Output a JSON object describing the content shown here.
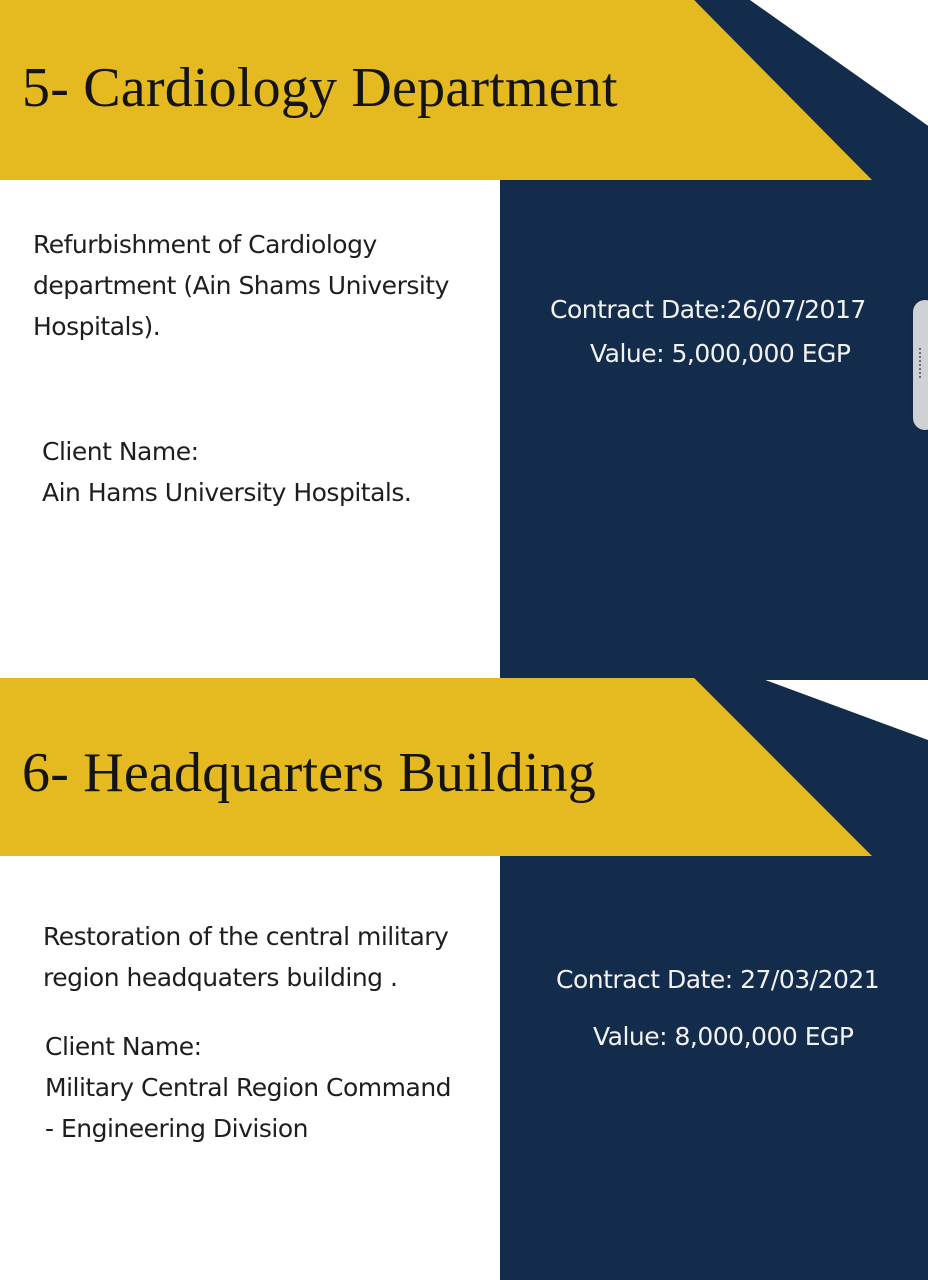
{
  "sections": [
    {
      "title": "5- Cardiology Department",
      "description_lines": [
        "Refurbishment of Cardiology",
        "department (Ain Shams University",
        "Hospitals)."
      ],
      "client_label": "Client Name:",
      "client_lines": [
        "Ain Hams University Hospitals."
      ],
      "contract_date": "Contract Date:26/07/2017",
      "value": "Value: 5,000,000 EGP"
    },
    {
      "title": "6- Headquarters Building",
      "description_lines": [
        "Restoration of the central military",
        "region headquaters building ."
      ],
      "client_label": "Client Name:",
      "client_lines": [
        "Military Central Region Command",
        "- Engineering Division"
      ],
      "contract_date": "Contract Date: 27/03/2021",
      "value": "Value: 8,000,000 EGP"
    }
  ],
  "colors": {
    "banner": "#e5b920",
    "navy": "#142c4b",
    "background": "#ffffff"
  },
  "icons": {
    "scroll_handle": "grip-dots-icon"
  }
}
